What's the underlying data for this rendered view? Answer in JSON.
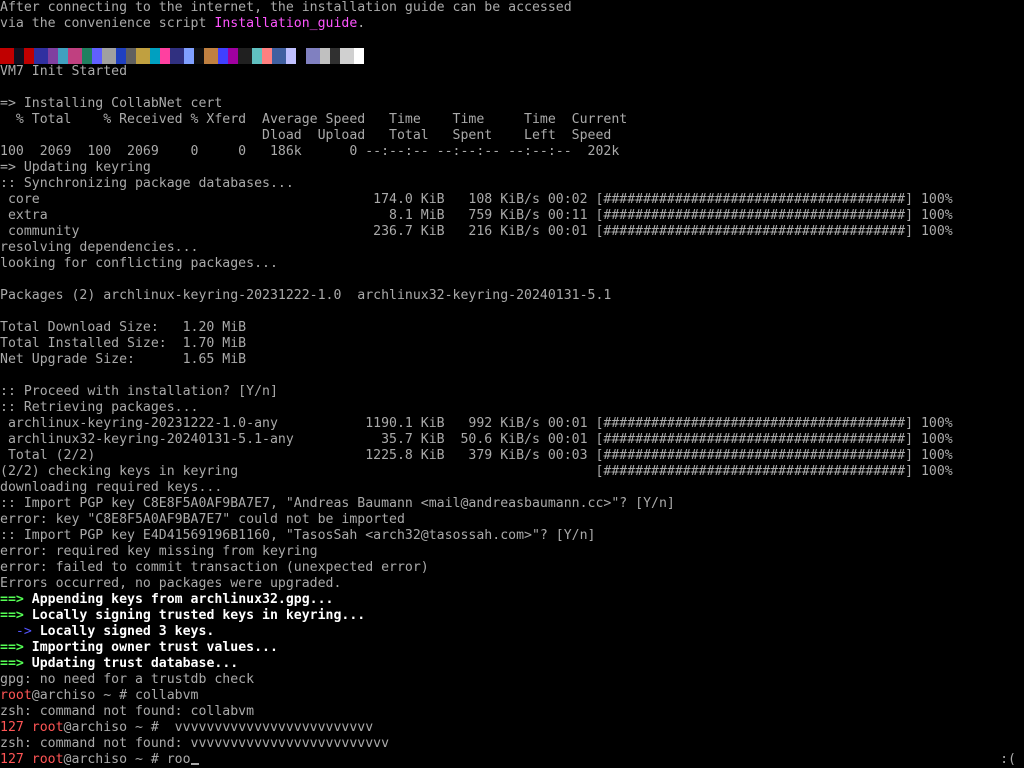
{
  "terminal": {
    "lines": [
      [
        {
          "t": "After connecting to the internet, the installation guide can be accessed",
          "c": "default"
        }
      ],
      [
        {
          "t": "via the convenience script ",
          "c": "default"
        },
        {
          "t": "Installation_guide",
          "c": "magenta"
        },
        {
          "t": ".",
          "c": "default"
        }
      ],
      [],
      "LOGO",
      [
        {
          "t": "VM7 Init Started",
          "c": "default"
        }
      ],
      [],
      [
        {
          "t": "=> Installing CollabNet cert",
          "c": "default"
        }
      ],
      [
        {
          "t": "  % Total    % Received % Xferd  Average Speed   Time    Time     Time  Current",
          "c": "default"
        }
      ],
      [
        {
          "t": "                                 Dload  Upload   Total   Spent    Left  Speed",
          "c": "default"
        }
      ],
      [
        {
          "t": "100  2069  100  2069    0     0   186k      0 --:--:-- --:--:-- --:--:--  202k",
          "c": "default"
        }
      ],
      [
        {
          "t": "=> Updating keyring",
          "c": "default"
        }
      ],
      [
        {
          "t": ":: Synchronizing package databases...",
          "c": "default"
        }
      ],
      [
        {
          "t": " core                                          174.0 KiB   108 KiB/s 00:02 [######################################] 100%",
          "c": "default"
        }
      ],
      [
        {
          "t": " extra                                           8.1 MiB   759 KiB/s 00:11 [######################################] 100%",
          "c": "default"
        }
      ],
      [
        {
          "t": " community                                     236.7 KiB   216 KiB/s 00:01 [######################################] 100%",
          "c": "default"
        }
      ],
      [
        {
          "t": "resolving dependencies...",
          "c": "default"
        }
      ],
      [
        {
          "t": "looking for conflicting packages...",
          "c": "default"
        }
      ],
      [],
      [
        {
          "t": "Packages (2) archlinux-keyring-20231222-1.0  archlinux32-keyring-20240131-5.1",
          "c": "default"
        }
      ],
      [],
      [
        {
          "t": "Total Download Size:   1.20 MiB",
          "c": "default"
        }
      ],
      [
        {
          "t": "Total Installed Size:  1.70 MiB",
          "c": "default"
        }
      ],
      [
        {
          "t": "Net Upgrade Size:      1.65 MiB",
          "c": "default"
        }
      ],
      [],
      [
        {
          "t": ":: Proceed with installation? [Y/n]",
          "c": "default"
        }
      ],
      [
        {
          "t": ":: Retrieving packages...",
          "c": "default"
        }
      ],
      [
        {
          "t": " archlinux-keyring-20231222-1.0-any           1190.1 KiB   992 KiB/s 00:01 [######################################] 100%",
          "c": "default"
        }
      ],
      [
        {
          "t": " archlinux32-keyring-20240131-5.1-any           35.7 KiB  50.6 KiB/s 00:01 [######################################] 100%",
          "c": "default"
        }
      ],
      [
        {
          "t": " Total (2/2)                                  1225.8 KiB   379 KiB/s 00:03 [######################################] 100%",
          "c": "default"
        }
      ],
      [
        {
          "t": "(2/2) checking keys in keyring                                             [######################################] 100%",
          "c": "default"
        }
      ],
      [
        {
          "t": "downloading required keys...",
          "c": "default"
        }
      ],
      [
        {
          "t": ":: Import PGP key C8E8F5A0AF9BA7E7, \"Andreas Baumann <mail@andreasbaumann.cc>\"? [Y/n]",
          "c": "default"
        }
      ],
      [
        {
          "t": "error: key \"C8E8F5A0AF9BA7E7\" could not be imported",
          "c": "default"
        }
      ],
      [
        {
          "t": ":: Import PGP key E4D41569196B1160, \"TasosSah <arch32@tasossah.com>\"? [Y/n]",
          "c": "default"
        }
      ],
      [
        {
          "t": "error: required key missing from keyring",
          "c": "default"
        }
      ],
      [
        {
          "t": "error: failed to commit transaction (unexpected error)",
          "c": "default"
        }
      ],
      [
        {
          "t": "Errors occurred, no packages were upgraded.",
          "c": "default"
        }
      ],
      [
        {
          "t": "==>",
          "c": "green"
        },
        {
          "t": " Appending keys from archlinux32.gpg...",
          "c": "bright"
        }
      ],
      [
        {
          "t": "==>",
          "c": "green"
        },
        {
          "t": " Locally signing trusted keys in keyring...",
          "c": "bright"
        }
      ],
      [
        {
          "t": "  -> ",
          "c": "blue"
        },
        {
          "t": "Locally signed 3 keys.",
          "c": "bright"
        }
      ],
      [
        {
          "t": "==>",
          "c": "green"
        },
        {
          "t": " Importing owner trust values...",
          "c": "bright"
        }
      ],
      [
        {
          "t": "==>",
          "c": "green"
        },
        {
          "t": " Updating trust database...",
          "c": "bright"
        }
      ],
      [
        {
          "t": "gpg: no need for a trustdb check",
          "c": "default"
        }
      ],
      [
        {
          "t": "root",
          "c": "red"
        },
        {
          "t": "@archiso ~ # collabvm",
          "c": "default"
        }
      ],
      [
        {
          "t": "zsh: command not found: collabvm",
          "c": "default"
        }
      ],
      [
        {
          "t": "127 ",
          "c": "red"
        },
        {
          "t": "root",
          "c": "red"
        },
        {
          "t": "@archiso ~ #  vvvvvvvvvvvvvvvvvvvvvvvvv",
          "c": "default"
        }
      ],
      [
        {
          "t": "zsh: command not found: vvvvvvvvvvvvvvvvvvvvvvvvv",
          "c": "default"
        }
      ],
      [
        {
          "t": "127 ",
          "c": "red"
        },
        {
          "t": "root",
          "c": "red"
        },
        {
          "t": "@archiso ~ # roo",
          "c": "default"
        },
        {
          "t": "CURSOR",
          "c": "cursor"
        }
      ]
    ],
    "corner_emote": ":(",
    "colors": {
      "background": "#000000",
      "text": "#aaaaaa",
      "bright": "#ffffff",
      "green": "#55ff55",
      "blue": "#5555ff",
      "magenta": "#ff55ff",
      "red": "#ff5555"
    }
  }
}
